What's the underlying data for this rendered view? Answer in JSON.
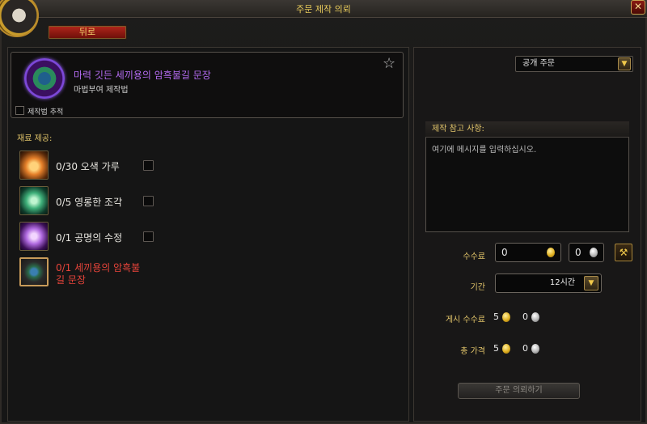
{
  "window": {
    "title": "주문 제작 의뢰",
    "close_label": "✕"
  },
  "back_label": "뒤로",
  "recipe": {
    "name": "마력 깃든 세끼용의 암흑불길 문장",
    "subtitle": "마법부여 제작법",
    "track_label": "제작법 추적",
    "favorite_icon": "star-icon",
    "track_checked": false
  },
  "reagents": {
    "title": "재료 제공:",
    "items": [
      {
        "text": "0/30 오색 가루",
        "icon": "prismatic-dust-icon",
        "color": "#e5802a",
        "checked": false
      },
      {
        "text": "0/5 영롱한 조각",
        "icon": "radiant-shard-icon",
        "color": "#3fb07a",
        "checked": false
      },
      {
        "text": "0/1 공명의 수정",
        "icon": "resonant-crystal-icon",
        "color": "#b06ae0",
        "checked": false
      },
      {
        "text": "0/1 세끼용의 암흑불\n길 문장",
        "icon": "dark-flame-emblem-icon",
        "color": "#e8443a"
      }
    ]
  },
  "order_type": {
    "value": "공개 주문",
    "arrow_icon": "chevron-down-icon"
  },
  "note": {
    "header": "제작 참고 사항:",
    "placeholder": "여기에 메시지를 입력하십시오."
  },
  "commission": {
    "label": "수수료",
    "gold": "0",
    "silver": "0",
    "hammer_icon": "hammer-icon"
  },
  "duration": {
    "label": "기간",
    "value": "12시간",
    "arrow_icon": "chevron-down-icon"
  },
  "posting_fee": {
    "label": "게시 수수료",
    "gold": "5",
    "silver": "0"
  },
  "total_price": {
    "label": "총 가격",
    "gold": "5",
    "silver": "0"
  },
  "submit_label": "주문 의뢰하기",
  "colors": {
    "gold_text": "#e2c56a",
    "epic_purple": "#b36bf0",
    "error_red": "#e8443a"
  }
}
